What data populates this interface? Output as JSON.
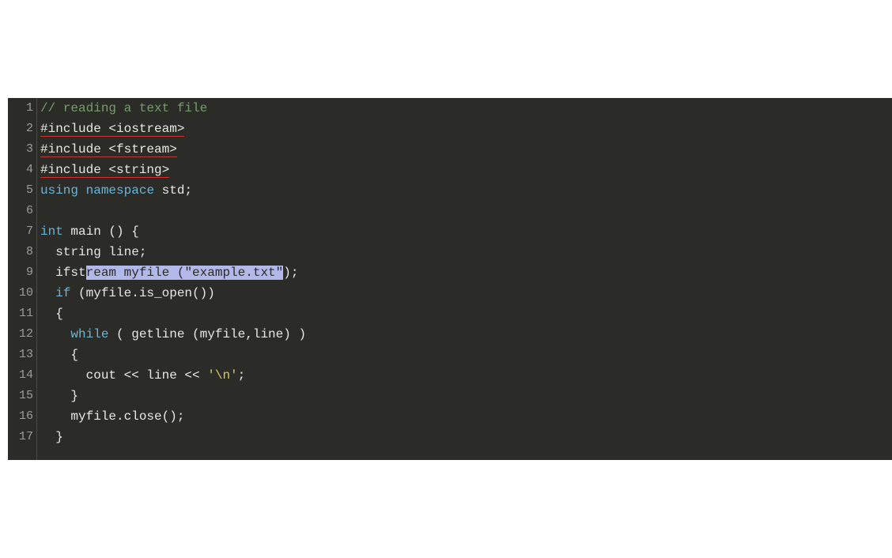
{
  "editor": {
    "lines": [
      {
        "num": "1",
        "tokens": [
          {
            "text": "// reading a text file",
            "class": "tok-comment"
          }
        ]
      },
      {
        "num": "2",
        "tokens": [
          {
            "text": "#include <iostream>",
            "class": "tok-default red-underline"
          }
        ]
      },
      {
        "num": "3",
        "tokens": [
          {
            "text": "#include <fstream>",
            "class": "tok-default red-underline"
          }
        ]
      },
      {
        "num": "4",
        "tokens": [
          {
            "text": "#include <string>",
            "class": "tok-default red-underline"
          }
        ]
      },
      {
        "num": "5",
        "tokens": [
          {
            "text": "using",
            "class": "tok-keyword"
          },
          {
            "text": " ",
            "class": "tok-default"
          },
          {
            "text": "namespace",
            "class": "tok-keyword"
          },
          {
            "text": " std;",
            "class": "tok-default"
          }
        ]
      },
      {
        "num": "6",
        "tokens": []
      },
      {
        "num": "7",
        "tokens": [
          {
            "text": "int",
            "class": "tok-keyword"
          },
          {
            "text": " main () {",
            "class": "tok-default"
          }
        ]
      },
      {
        "num": "8",
        "tokens": [
          {
            "text": "  string line;",
            "class": "tok-default"
          }
        ]
      },
      {
        "num": "9",
        "tokens": [
          {
            "text": "  ifst",
            "class": "tok-default"
          },
          {
            "text": "ream myfile (",
            "class": "tok-default selection"
          },
          {
            "text": "\"example.txt\"",
            "class": "tok-string selection"
          },
          {
            "text": ");",
            "class": "tok-default"
          }
        ]
      },
      {
        "num": "10",
        "tokens": [
          {
            "text": "  ",
            "class": "tok-default"
          },
          {
            "text": "if",
            "class": "tok-keyword"
          },
          {
            "text": " (myfile.is_open())",
            "class": "tok-default"
          }
        ]
      },
      {
        "num": "11",
        "tokens": [
          {
            "text": "  {",
            "class": "tok-default"
          }
        ]
      },
      {
        "num": "12",
        "tokens": [
          {
            "text": "    ",
            "class": "tok-default"
          },
          {
            "text": "while",
            "class": "tok-keyword"
          },
          {
            "text": " ( getline (myfile,line) )",
            "class": "tok-default"
          }
        ]
      },
      {
        "num": "13",
        "tokens": [
          {
            "text": "    {",
            "class": "tok-default"
          }
        ]
      },
      {
        "num": "14",
        "tokens": [
          {
            "text": "      cout << line << ",
            "class": "tok-default"
          },
          {
            "text": "'\\n'",
            "class": "tok-string"
          },
          {
            "text": ";",
            "class": "tok-default"
          }
        ]
      },
      {
        "num": "15",
        "tokens": [
          {
            "text": "    }",
            "class": "tok-default"
          }
        ]
      },
      {
        "num": "16",
        "tokens": [
          {
            "text": "    myfile.close();",
            "class": "tok-default"
          }
        ]
      },
      {
        "num": "17",
        "tokens": [
          {
            "text": "  }",
            "class": "tok-default"
          }
        ]
      }
    ]
  }
}
